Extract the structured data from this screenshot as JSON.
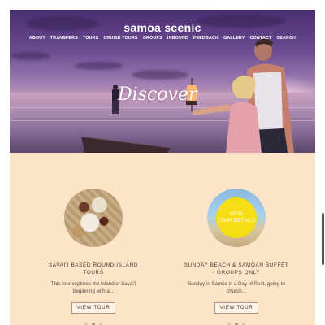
{
  "brand": {
    "logo_text": "samoa scenic"
  },
  "nav": {
    "items": [
      "ABOUT",
      "TRANSFERS",
      "TOURS",
      "CRUISE TOURS",
      "GROUPS",
      "INBOUND",
      "FEEDBACK",
      "GALLERY",
      "CONTACT",
      "SEARCH"
    ]
  },
  "hero": {
    "headline": "Discover"
  },
  "tours": [
    {
      "title": "SAVAI'I BASED ROUND ISLAND TOURS",
      "description": "This tour explores the Island of Savai'i beginning with a...",
      "button_label": "VIEW TOUR",
      "active_dot": 1
    },
    {
      "title": "SUNDAY BEACH & SAMOAN BUFFET - GROUPS ONLY",
      "description": "Sunday in Samoa is a Day of Rest, going to church...",
      "button_label": "VIEW TOUR",
      "badge_line1": "VIEW",
      "badge_line2": "TOUR DETAILS",
      "active_dot": 1
    }
  ],
  "colors": {
    "page_background": "#fde4c8",
    "badge_yellow": "#f7de14",
    "text": "#4a3a32"
  }
}
